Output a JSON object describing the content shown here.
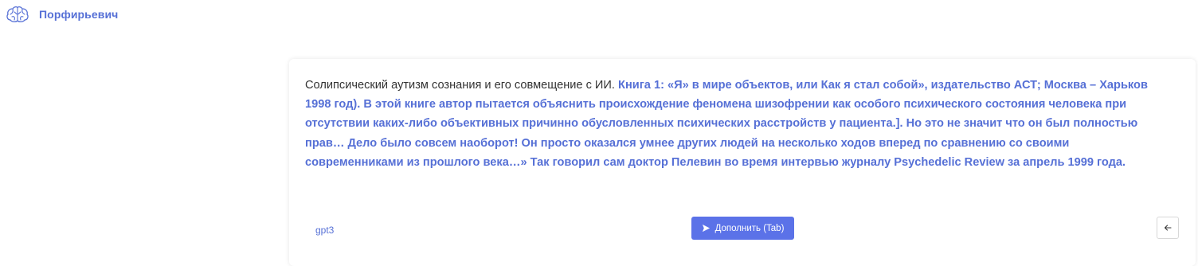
{
  "header": {
    "brand": "Порфирьевич",
    "logo_icon": "brain-icon"
  },
  "editor": {
    "prompt_text": "Солипсический аутизм сознания и его совмещение с ИИ. ",
    "generated_text": "Книга 1: «Я» в мире объектов, или Как я стал собой», издательство АСТ; Москва – Харьков 1998 год). В этой книге автор пытается объяснить происхождение феномена шизофрении как особого психического состояния человека при отсутствии каких-либо объективных причинно обусловленных психических расстройств у пациента.]. Но это не значит что он был полностью прав… Дело было совсем наоборот! Он просто оказался умнее других людей на несколько ходов вперед по сравнению со своими современниками из прошлого века…» Так говорил сам доктор Пелевин во время интервью журналу Psychedelic Review за апрель 1999 года."
  },
  "footer": {
    "model": "gpt3",
    "complete_label": "Дополнить (Tab)",
    "complete_icon": "send-icon",
    "back_icon": "arrow-left-icon"
  },
  "colors": {
    "accent": "#5670d6",
    "button": "#5b72e8",
    "text": "#333333"
  }
}
